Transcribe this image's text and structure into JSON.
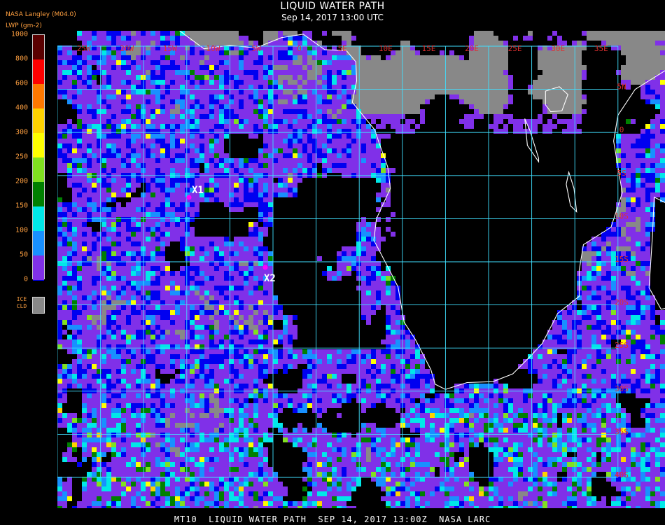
{
  "header": {
    "title": "LIQUID WATER PATH",
    "subtitle": "Sep 14, 2017 13:00 UTC",
    "source": "NASA Langley (M04.0)",
    "units": "LWP (gm-2)"
  },
  "legend": {
    "steps": [
      {
        "label": "1000",
        "color": "#5a0000"
      },
      {
        "label": "800",
        "color": "#ff0000"
      },
      {
        "label": "600",
        "color": "#ff7800"
      },
      {
        "label": "400",
        "color": "#ffd200"
      },
      {
        "label": "300",
        "color": "#ffff00"
      },
      {
        "label": "250",
        "color": "#80e020"
      },
      {
        "label": "200",
        "color": "#008000"
      },
      {
        "label": "150",
        "color": "#00e8e8"
      },
      {
        "label": "100",
        "color": "#1890ff"
      },
      {
        "label": "50",
        "color": "#0000f0"
      },
      {
        "label": "0",
        "color": "#8030e8"
      }
    ],
    "ice_label_line1": "ICE",
    "ice_label_line2": "CLD",
    "ice_color": "#888888"
  },
  "map": {
    "lon_labels": [
      "25W",
      "20W",
      "15W",
      "10W",
      "5W",
      "0",
      "5E",
      "10E",
      "15E",
      "20E",
      "25E",
      "30E",
      "35E"
    ],
    "lat_labels": [
      "5N",
      "0",
      "5S",
      "10S",
      "15S",
      "20S",
      "25S",
      "30S",
      "35S",
      "40S"
    ],
    "markers": [
      {
        "label": "X1",
        "color": "#ff00ff"
      },
      {
        "label": "X2",
        "color": "#ff00ff"
      }
    ],
    "grid_color": "#40e0ff",
    "coast_color": "#ffffff",
    "label_color": "#e03030"
  },
  "footer": "MT10  LIQUID WATER PATH  SEP 14, 2017 13:00Z  NASA LARC"
}
